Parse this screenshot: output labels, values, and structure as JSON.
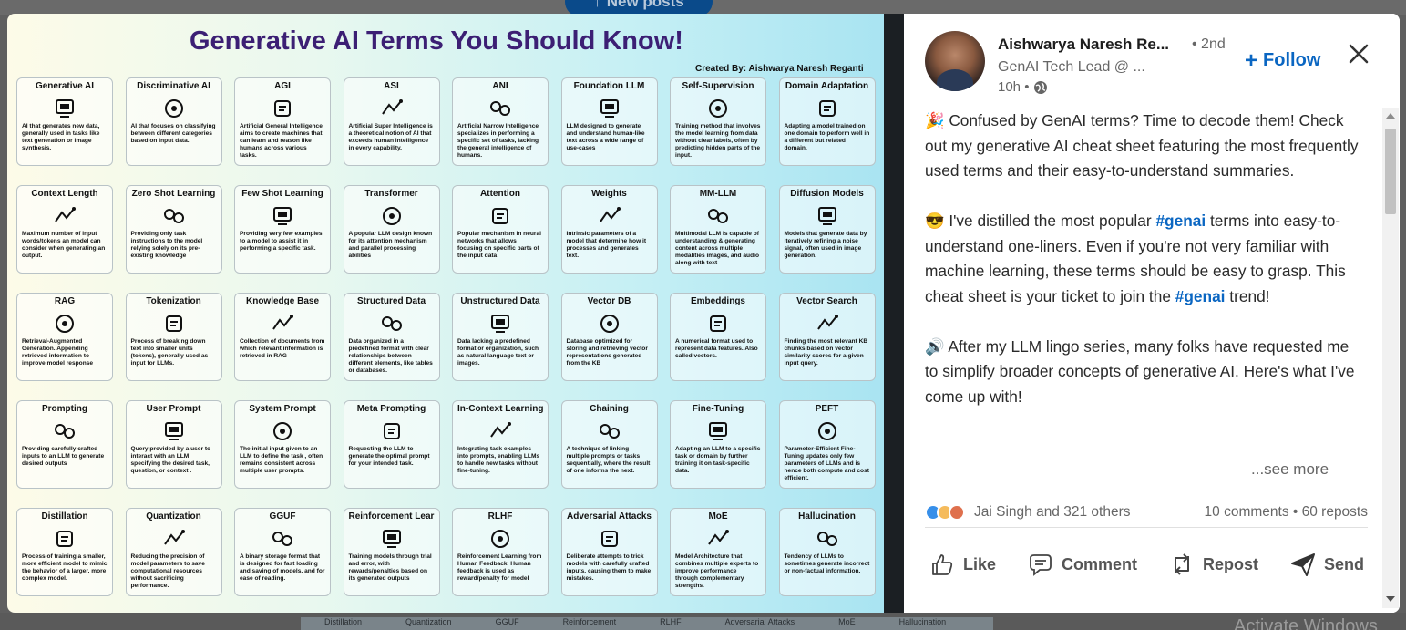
{
  "backdrop": {
    "new_posts_label": "New posts",
    "strip_labels": [
      "Distillation",
      "Quantization",
      "GGUF",
      "Reinforcement",
      "RLHF",
      "Adversarial Attacks",
      "MoE",
      "Hallucination"
    ],
    "activate_text": "Activate Windows"
  },
  "sheet": {
    "title": "Generative AI Terms You Should Know!",
    "credit": "Created By: Aishwarya Naresh Reganti",
    "cards": [
      {
        "title": "Generative AI",
        "icon": "gear-icon",
        "desc": "AI that generates new data, generally used in tasks like text generation or image synthesis."
      },
      {
        "title": "Discriminative AI",
        "icon": "scatter-icon",
        "desc": "AI that focuses on classifying between different categories based on input data."
      },
      {
        "title": "AGI",
        "icon": "brain-icon",
        "desc": "Artificial General Intelligence aims to create machines that can learn and reason like humans across various tasks."
      },
      {
        "title": "ASI",
        "icon": "head-gear-icon",
        "desc": "Artificial Super Intelligence is a theoretical notion of AI that exceeds human intelligence in every capability."
      },
      {
        "title": "ANI",
        "icon": "narrow-arrows-icon",
        "desc": "Artificial Narrow Intelligence specializes in performing a specific set of tasks, lacking the general intelligence of humans."
      },
      {
        "title": "Foundation LLM",
        "icon": "robot-icon",
        "desc": "LLM designed to generate and understand human-like text across a wide range of use-cases"
      },
      {
        "title": "Self-Supervision",
        "icon": "eye-icon",
        "desc": "Training method that involves the model learning from data without clear labels, often by predicting hidden parts of the input."
      },
      {
        "title": "Domain Adaptation",
        "icon": "cube-icon",
        "desc": "Adapting a model trained on one domain to perform well in a different but related domain."
      },
      {
        "title": "Context Length",
        "icon": "sparkle-icon",
        "desc": "Maximum number of input words/tokens an model can consider when generating an output."
      },
      {
        "title": "Zero Shot Learning",
        "icon": "chat-icon",
        "desc": "Providing only task instructions to the model relying solely on its pre-existing knowledge"
      },
      {
        "title": "Few Shot Learning",
        "icon": "quote-bubbles-icon",
        "desc": "Providing very few examples to a model to assist it in performing a specific task."
      },
      {
        "title": "Transformer",
        "icon": "layers-icon",
        "desc": "A popular LLM design known for its attention mechanism and parallel processing abilities"
      },
      {
        "title": "Attention",
        "icon": "flow-icon",
        "desc": "Popular mechanism in neural networks that allows focusing on specific parts of the input data"
      },
      {
        "title": "Weights",
        "icon": "sliders-icon",
        "desc": "Intrinsic parameters of a model that determine how it processes and generates text."
      },
      {
        "title": "MM-LLM",
        "icon": "multimodal-icon",
        "desc": "Multimodal LLM is capable of understanding & generating content across multiple modalities images, and audio along with text"
      },
      {
        "title": "Diffusion Models",
        "icon": "diffusion-icon",
        "desc": "Models that generate data by iteratively refining a noise signal, often used in image generation."
      },
      {
        "title": "RAG",
        "icon": "book-icon",
        "desc": "Retrieval-Augmented Generation. Appending retrieved information to improve model response"
      },
      {
        "title": "Tokenization",
        "icon": "blocks-icon",
        "desc": "Process of breaking down text into smaller units (tokens), generally used as input for LLMs."
      },
      {
        "title": "Knowledge Base",
        "icon": "document-icon",
        "desc": "Collection of documents from which relevant information is retrieved in RAG"
      },
      {
        "title": "Structured Data",
        "icon": "database-icon",
        "desc": "Data organized in a predefined format with clear relationships between different elements, like tables or databases."
      },
      {
        "title": "Unstructured Data",
        "icon": "images-icon",
        "desc": "Data lacking a predefined format or organization, such as natural language text or images."
      },
      {
        "title": "Vector DB",
        "icon": "vector-db-icon",
        "desc": "Database optimized for storing and retrieving vector representations generated from the KB"
      },
      {
        "title": "Embeddings",
        "icon": "embedding-icon",
        "desc": "A numerical format used to represent data features. Also called vectors."
      },
      {
        "title": "Vector Search",
        "icon": "search-doc-icon",
        "desc": "Finding the most relevant KB chunks based on vector similarity scores for a given input query."
      },
      {
        "title": "Prompting",
        "icon": "prompt-icon",
        "desc": "Providing carefully crafted inputs to an LLM to generate desired outputs"
      },
      {
        "title": "User Prompt",
        "icon": "user-icon",
        "desc": "Query provided by a user to interact with an LLM specifying the desired task, question, or context ."
      },
      {
        "title": "System Prompt",
        "icon": "system-icon",
        "desc": "The initial input given to an LLM to define the task , often remains consistent across multiple user prompts."
      },
      {
        "title": "Meta Prompting",
        "icon": "meta-icon",
        "desc": "Requesting the LLM to generate the optimal prompt for your intended task."
      },
      {
        "title": "In-Context Learning",
        "icon": "context-bubble-icon",
        "desc": "Integrating task examples into prompts, enabling LLMs to handle new tasks without fine-tuning."
      },
      {
        "title": "Chaining",
        "icon": "chain-icon",
        "desc": "A technique of linking multiple prompts or tasks sequentially, where the result of one informs the next."
      },
      {
        "title": "Fine-Tuning",
        "icon": "tune-icon",
        "desc": "Adapting an LLM to a specific task or domain by further training it on task-specific data."
      },
      {
        "title": "PEFT",
        "icon": "peft-icon",
        "desc": "Parameter-Efficient Fine-Tuning updates only few parameters of LLMs and is hence both compute and cost efficient."
      },
      {
        "title": "Distillation",
        "icon": "distill-icon",
        "desc": "Process of training a smaller, more efficient model to mimic the behavior of a larger, more complex model."
      },
      {
        "title": "Quantization",
        "icon": "quant-icon",
        "desc": "Reducing the precision of model parameters to save computational resources without sacrificing performance."
      },
      {
        "title": "GGUF",
        "icon": "box-icon",
        "desc": "A binary storage format that is designed for fast loading and saving of models, and for ease of reading."
      },
      {
        "title": "Reinforcement Learning",
        "icon": "faces-icon",
        "desc": "Training models through trial and error, with rewards/penalties based on its generated outputs"
      },
      {
        "title": "RLHF",
        "icon": "rlhf-icon",
        "desc": "Reinforcement Learning from Human Feedback. Human feedback is used as reward/penalty for model"
      },
      {
        "title": "Adversarial Attacks",
        "icon": "hacker-icon",
        "desc": "Deliberate attempts to trick models with carefully crafted inputs, causing them to make mistakes."
      },
      {
        "title": "MoE",
        "icon": "experts-icon",
        "desc": "Model Architecture that combines multiple experts to improve performance through complementary strengths."
      },
      {
        "title": "Hallucination",
        "icon": "spiral-icon",
        "desc": "Tendency of LLMs to sometimes generate incorrect or non-factual information."
      }
    ]
  },
  "author": {
    "name": "Aishwarya Naresh Re...",
    "degree": "• 2nd",
    "headline": "GenAI Tech Lead @ ...",
    "time": "10h •",
    "follow_label": "Follow"
  },
  "post": {
    "p1": "🎉 Confused by GenAI terms? Time to decode them! Check out my generative AI cheat sheet featuring the most frequently used terms and their easy-to-understand summaries.",
    "p2_a": "😎 I've distilled the most popular ",
    "p2_tag1": "#genai",
    "p2_b": " terms into easy-to-understand one-liners. Even if you're not very familiar with machine learning, these terms should be easy to grasp. This cheat sheet is your ticket to join the ",
    "p2_tag2": "#genai",
    "p2_c": " trend!",
    "p3": "🔊 After my LLM lingo series, many folks have requested me to simplify broader concepts of generative AI. Here's what I've come up with!",
    "see_more": "...see more"
  },
  "social": {
    "reactors": "Jai Singh and 321 others",
    "stats": "10 comments • 60 reposts"
  },
  "actions": {
    "like": "Like",
    "comment": "Comment",
    "repost": "Repost",
    "send": "Send"
  },
  "colors": {
    "accent": "#0a66c2",
    "title_purple": "#3c1f74"
  }
}
